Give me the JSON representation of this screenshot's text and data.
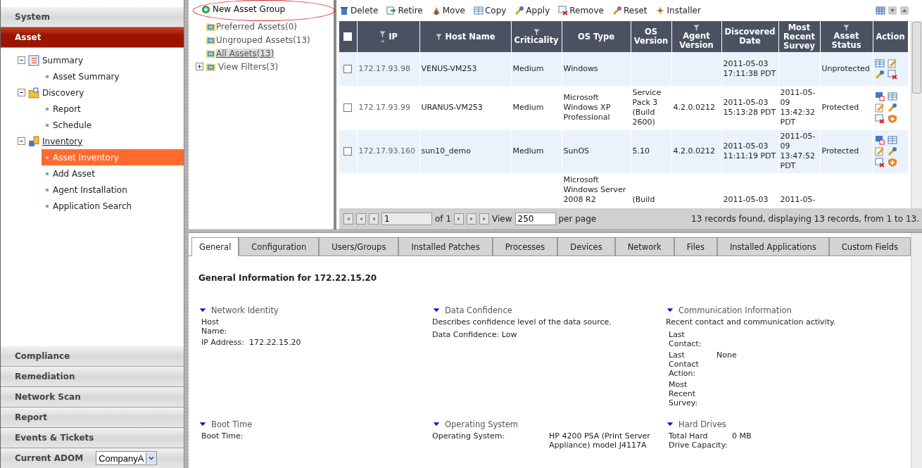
{
  "sidebar": {
    "top_sections": [
      {
        "label": "System",
        "selected": false
      },
      {
        "label": "Asset",
        "selected": true
      }
    ],
    "tree": [
      {
        "label": "Summary",
        "link": false,
        "expanded": true,
        "children": [
          {
            "label": "Asset Summary",
            "selected": false
          }
        ]
      },
      {
        "label": "Discovery",
        "link": false,
        "expanded": true,
        "children": [
          {
            "label": "Report",
            "selected": false
          },
          {
            "label": "Schedule",
            "selected": false
          }
        ]
      },
      {
        "label": "Inventory",
        "link": true,
        "expanded": true,
        "children": [
          {
            "label": "Asset Inventory",
            "selected": true
          },
          {
            "label": "Add Asset",
            "selected": false
          },
          {
            "label": "Agent Installation",
            "selected": false
          },
          {
            "label": "Application Search",
            "selected": false
          }
        ]
      }
    ],
    "bottom_sections": [
      {
        "label": "Compliance"
      },
      {
        "label": "Remediation"
      },
      {
        "label": "Network Scan"
      },
      {
        "label": "Report"
      },
      {
        "label": "Events & Tickets"
      }
    ],
    "adom": {
      "label": "Current ADOM",
      "value": "CompanyA"
    }
  },
  "groups": {
    "new_button": "New Asset Group",
    "items": [
      {
        "label": "Preferred Assets(0)",
        "kind": "group",
        "selected": false
      },
      {
        "label": "Ungrouped Assets(13)",
        "kind": "group",
        "selected": false
      },
      {
        "label": "All Assets(13)",
        "kind": "group",
        "selected": true
      },
      {
        "label": "View Filters(3)",
        "kind": "filter",
        "selected": false
      }
    ]
  },
  "toolbar": [
    {
      "label": "Delete"
    },
    {
      "label": "Retire"
    },
    {
      "label": "Move"
    },
    {
      "label": "Copy"
    },
    {
      "label": "Apply"
    },
    {
      "label": "Remove"
    },
    {
      "label": "Reset"
    },
    {
      "label": "Installer"
    }
  ],
  "table": {
    "select_all_checked": false,
    "columns": [
      {
        "label": "IP",
        "filter": true,
        "sorted": true
      },
      {
        "label": "Host Name",
        "filter": true,
        "sorted": false
      },
      {
        "label": "Criticality",
        "filter": true,
        "sorted": false
      },
      {
        "label": "OS Type",
        "filter": false,
        "sorted": false
      },
      {
        "label": "OS Version",
        "filter": false,
        "sorted": false
      },
      {
        "label": "Agent Version",
        "filter": true,
        "sorted": false
      },
      {
        "label": "Discovered Date",
        "filter": false,
        "sorted": false
      },
      {
        "label": "Most Recent Survey",
        "filter": false,
        "sorted": false
      },
      {
        "label": "Asset Status",
        "filter": true,
        "sorted": false
      },
      {
        "label": "Action",
        "filter": false,
        "sorted": false
      }
    ],
    "rows": [
      {
        "checked": false,
        "agent": false,
        "cells": [
          "172.17.93.98",
          "VENUS-VM253",
          "Medium",
          "Windows",
          "",
          "",
          "2011-05-03 17:11:38 PDT",
          "",
          "Unprotected"
        ]
      },
      {
        "checked": false,
        "agent": true,
        "cells": [
          "172.17.93.99",
          "URANUS-VM253",
          "Medium",
          "Microsoft Windows XP Professional",
          "Service Pack 3 (Build 2600)",
          "4.2.0.0212",
          "2011-05-03 15:13:28 PDT",
          "2011-05-09 13:42:32 PDT",
          "Protected"
        ]
      },
      {
        "checked": false,
        "agent": true,
        "cells": [
          "172.17.93.160",
          "sun10_demo",
          "Medium",
          "SunOS",
          "5.10",
          "4.2.0.0212",
          "2011-05-03 11:11:19 PDT",
          "2011-05-09 13:47:52 PDT",
          "Protected"
        ]
      },
      {
        "cells": [
          "",
          "",
          "",
          "Microsoft Windows Server 2008 R2",
          "(Build",
          "",
          "2011-05-03",
          "2011-05-",
          "",
          ""
        ]
      }
    ]
  },
  "pager": {
    "page": "1",
    "of": "of 1",
    "view_label": "View",
    "view": "250",
    "per_page": "per page",
    "summary": "13 records found, displaying 13 records, from 1 to 13."
  },
  "details": {
    "tabs": [
      {
        "label": "General",
        "selected": true
      },
      {
        "label": "Configuration",
        "selected": false
      },
      {
        "label": "Users/Groups",
        "selected": false
      },
      {
        "label": "Installed Patches",
        "selected": false
      },
      {
        "label": "Processes",
        "selected": false
      },
      {
        "label": "Devices",
        "selected": false
      },
      {
        "label": "Network",
        "selected": false
      },
      {
        "label": "Files",
        "selected": false
      },
      {
        "label": "Installed Applications",
        "selected": false
      },
      {
        "label": "Custom Fields",
        "selected": false
      }
    ],
    "heading": "General Information for 172.22.15.20",
    "sections": [
      {
        "title": "Network Identity",
        "kind": "table",
        "fields": [
          {
            "label": "Host Name:"
          },
          {
            "label": "IP Address:",
            "value": "172.22.15.20"
          }
        ]
      },
      {
        "title": "Data Confidence",
        "kind": "inline",
        "description": "Describes confidence level of the data source.",
        "fields": [
          {
            "label": "Data Confidence:",
            "value": "Low"
          }
        ]
      },
      {
        "title": "Communication Information",
        "kind": "table",
        "description": "Recent contact and communication activity.",
        "fields": [
          {
            "label": "Last Contact:"
          },
          {
            "label": "Last Contact Action:",
            "value": "None"
          },
          {
            "label": "Most Recent Survey:"
          }
        ]
      },
      {
        "title": "Boot Time",
        "kind": "table",
        "fields": [
          {
            "label": "Boot Time:"
          }
        ]
      },
      {
        "title": "Operating System",
        "kind": "wide",
        "fields": [
          {
            "label": "Operating System:",
            "value": "HP 4200 PSA (Print Server Appliance) model J4117A"
          }
        ]
      },
      {
        "title": "Hard Drives",
        "kind": "table",
        "fields": [
          {
            "label": "Total Hard Drive Capacity:",
            "value": "0 MB"
          }
        ]
      }
    ]
  }
}
